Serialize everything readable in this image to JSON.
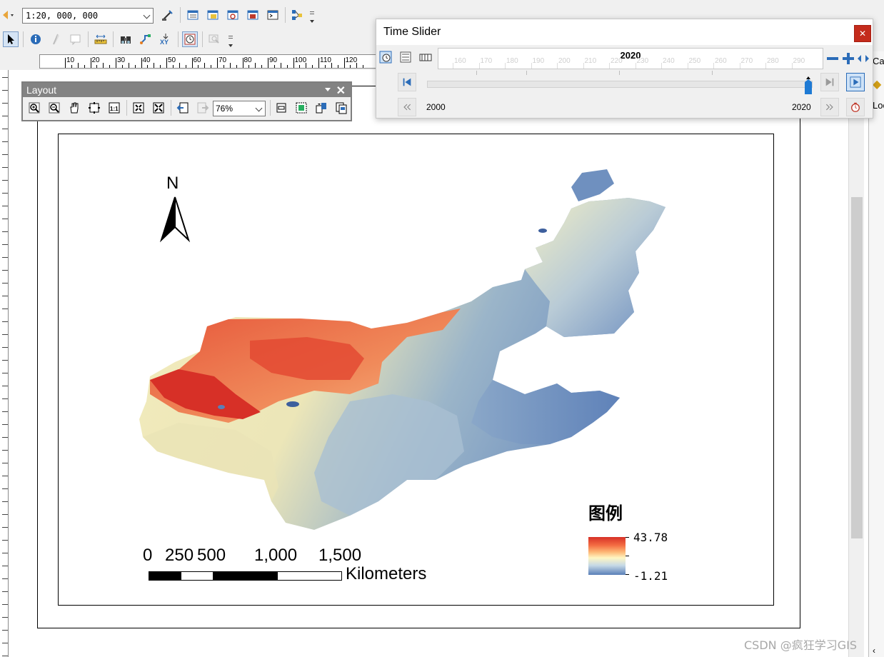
{
  "toolbar": {
    "map_scale": "1:20, 000, 000"
  },
  "ruler": {
    "labels": [
      "10",
      "20",
      "30",
      "40",
      "50",
      "60",
      "70",
      "80",
      "90",
      "100",
      "110",
      "120"
    ]
  },
  "layout_toolbar": {
    "title": "Layout",
    "close": "✕",
    "zoom_percent": "76%"
  },
  "time_slider": {
    "title": "Time Slider",
    "close": "✕",
    "current_time": "2020",
    "start_time": "2000",
    "end_time": "2020",
    "timeline_labels": [
      "160",
      "170",
      "180",
      "190",
      "200",
      "210",
      "220",
      "230",
      "240",
      "250",
      "260",
      "270",
      "280",
      "290"
    ],
    "playback_position": 1.0
  },
  "map": {
    "north_letter": "N",
    "scale_bar_labels": [
      "0",
      "250",
      "500",
      "1,000",
      "1,500"
    ],
    "scale_bar_units": "Kilometers",
    "legend": {
      "title": "图例",
      "max": "43.78",
      "min": "-1.21"
    },
    "colors": {
      "high": "#d73027",
      "mid": "#fff6c2",
      "low": "#5a7fb8"
    }
  },
  "side_panel": {
    "tab1": "Ca",
    "tab2": "Loc"
  },
  "watermark": "CSDN @疯狂学习GIS"
}
